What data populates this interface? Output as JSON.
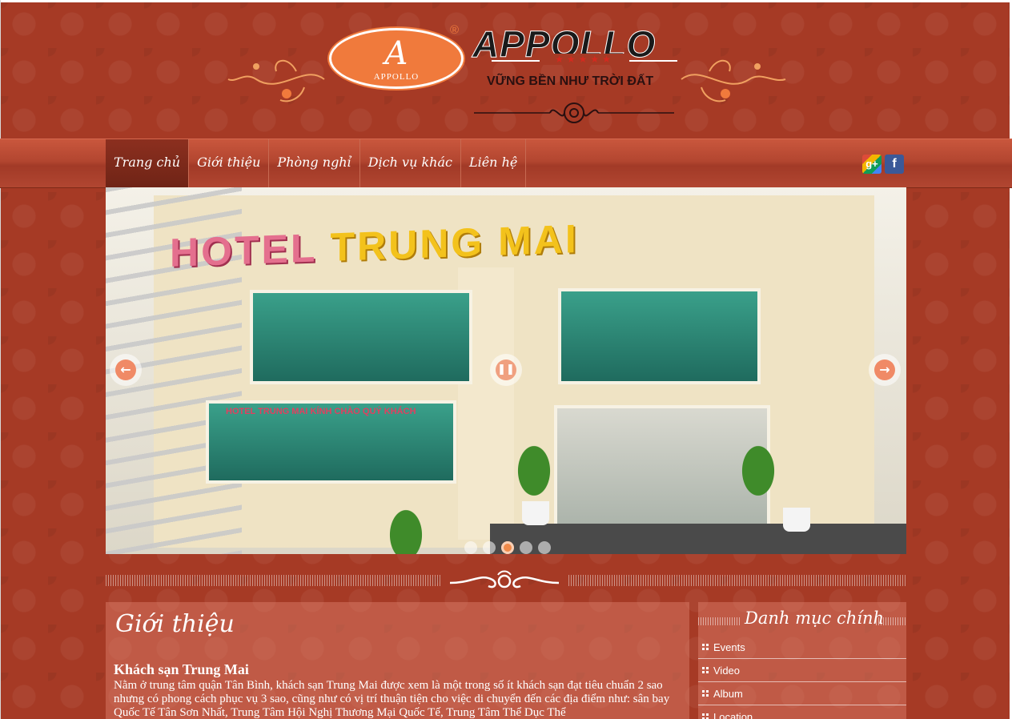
{
  "brand": {
    "logo_letter": "A",
    "logo_small": "APPOLLO",
    "registered": "®",
    "name": "APPOLLO",
    "stars": "★★★★★",
    "slogan": "VỮNG BỀN NHƯ TRỜI ĐẤT"
  },
  "nav": {
    "items": [
      {
        "label": "Trang chủ",
        "active": true
      },
      {
        "label": "Giới thiệu"
      },
      {
        "label": "Phòng nghỉ"
      },
      {
        "label": "Dịch vụ khác"
      },
      {
        "label": "Liên hệ"
      }
    ],
    "social": [
      {
        "name": "google-plus",
        "glyph": "g+"
      },
      {
        "name": "facebook",
        "glyph": "f"
      }
    ]
  },
  "slider": {
    "image_text_red": "HOTEL",
    "image_text_yellow": "TRUNG MAI",
    "image_sign": "HOTEL TRUNG MAI KÍNH CHÀO QUÝ KHÁCH",
    "prev_glyph": "←",
    "next_glyph": "→",
    "pause_glyph": "❚❚",
    "dots": 5,
    "active_dot": 3
  },
  "intro": {
    "title": "Giới thiệu",
    "subtitle": "Khách sạn Trung Mai",
    "text": "Nằm ở trung tâm quận Tân Bình, khách sạn Trung Mai được xem là một trong số ít khách sạn đạt tiêu chuẩn 2 sao nhưng có phong cách phục vụ 3 sao, cũng như có vị trí thuận tiện cho việc di chuyển đến các địa điểm như: sân bay Quốc Tế Tân Sơn Nhất, Trung Tâm Hội Nghị Thương Mại Quốc Tế, Trung Tâm Thể Dục Thể"
  },
  "sidebar": {
    "title": "Danh mục chính",
    "items": [
      {
        "label": "Events"
      },
      {
        "label": "Video"
      },
      {
        "label": "Album"
      },
      {
        "label": "Location"
      }
    ]
  },
  "colors": {
    "background": "#a63a25",
    "accent": "#f07a3c",
    "nav": "#b34630"
  }
}
